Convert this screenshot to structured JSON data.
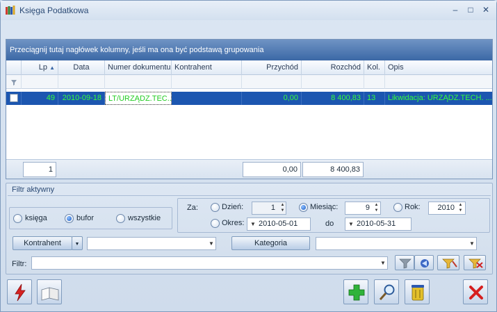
{
  "window": {
    "title": "Księga Podatkowa",
    "controls": {
      "minimize": "–",
      "maximize": "□",
      "close": "✕"
    }
  },
  "grid": {
    "group_hint": "Przeciągnij tutaj nagłówek kolumny, jeśli ma ona być podstawą grupowania",
    "columns": [
      "Lp",
      "Data",
      "Numer dokumentu",
      "Kontrahent",
      "Przychód",
      "Rozchód",
      "Kol.",
      "Opis"
    ],
    "sort_indicator": "▲",
    "rows": [
      {
        "lp": "49",
        "data": "2010-09-18",
        "numer": "LT/URZĄDZ.TEC...",
        "kontrahent": "",
        "przychod": "0,00",
        "rozchod": "8 400,83",
        "kol": "13",
        "opis": "Likwidacja: URZĄDZ.TECH. ..."
      }
    ],
    "footer": {
      "count": "1",
      "przychod_total": "0,00",
      "rozchod_total": "8 400,83"
    }
  },
  "filter": {
    "title": "Filtr aktywny",
    "scope": {
      "options": [
        "księga",
        "bufor",
        "wszystkie"
      ],
      "selected": "bufor"
    },
    "za_label": "Za:",
    "dzien": {
      "label": "Dzień:",
      "value": "1"
    },
    "miesiac": {
      "label": "Miesiąc:",
      "value": "9"
    },
    "rok": {
      "label": "Rok:",
      "value": "2010"
    },
    "okres": {
      "label": "Okres:",
      "from": "2010-05-01",
      "do_label": "do",
      "to": "2010-05-31"
    },
    "period_selected": "miesiac",
    "kontrahent_button": "Kontrahent",
    "kontrahent_value": "",
    "kategoria_button": "Kategoria",
    "kategoria_value": "",
    "filtr_label": "Filtr:",
    "filtr_value": ""
  },
  "colors": {
    "selection_bg": "#1c56b0",
    "selection_text": "#35ff3a",
    "header_bar": "#3b68a6"
  }
}
